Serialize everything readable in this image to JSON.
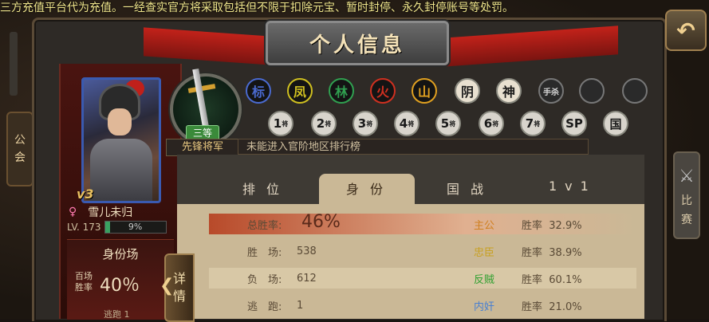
{
  "marquee": "三方充值平台代为充值。一经查实官方将采取包括但不限于扣除元宝、暂时封停、永久封停账号等处罚。",
  "title": "个人信息",
  "back_icon": "↶",
  "side_left": {
    "label1": "公",
    "label2": "会"
  },
  "side_right": {
    "label1": "比",
    "label2": "赛"
  },
  "profile": {
    "vip": "v3",
    "gender": "♀",
    "name": "雪儿未归",
    "level": "LV. 173",
    "exp_percent": "9%",
    "exp_fraction": 0.09,
    "id_title": "身份场",
    "id_sub1": "百场",
    "id_sub2": "胜率",
    "id_percent": "40％",
    "escape": "逃跑 1",
    "detail1": "详",
    "detail2": "情"
  },
  "rank": {
    "tag": "三等",
    "name": "先锋将军",
    "status": "未能进入官阶地区排行榜"
  },
  "badges_row1": [
    {
      "text": "标",
      "color": "#4a6ad0"
    },
    {
      "text": "凤",
      "color": "#d0c020"
    },
    {
      "text": "林",
      "color": "#30a050"
    },
    {
      "text": "火",
      "color": "#d03020"
    },
    {
      "text": "山",
      "color": "#e0a020"
    },
    {
      "text": "阴",
      "color": "grey"
    },
    {
      "text": "神",
      "color": "grey"
    },
    {
      "text": "手杀",
      "color": "dark"
    },
    {
      "text": "",
      "color": "dark"
    },
    {
      "text": "",
      "color": "dark"
    }
  ],
  "badges_row2": [
    {
      "num": "1",
      "sub": "将"
    },
    {
      "num": "2",
      "sub": "将"
    },
    {
      "num": "3",
      "sub": "将"
    },
    {
      "num": "4",
      "sub": "将"
    },
    {
      "num": "5",
      "sub": "将"
    },
    {
      "num": "6",
      "sub": "将"
    },
    {
      "num": "7",
      "sub": "将"
    },
    {
      "num": "SP",
      "sub": ""
    },
    {
      "num": "国",
      "sub": ""
    }
  ],
  "tabs": [
    "排位",
    "身份",
    "国战",
    "1v1"
  ],
  "stats": [
    {
      "label": "总胜率:",
      "value": "46%"
    },
    {
      "label": "胜　场:",
      "value": "538"
    },
    {
      "label": "负　场:",
      "value": "612"
    },
    {
      "label": "逃　跑:",
      "value": "1"
    }
  ],
  "roles": [
    {
      "name": "主公",
      "color": "#d08020",
      "rate_label": "胜率",
      "rate": "32.9%"
    },
    {
      "name": "忠臣",
      "color": "#c8a020",
      "rate_label": "胜率",
      "rate": "38.9%"
    },
    {
      "name": "反贼",
      "color": "#30a030",
      "rate_label": "胜率",
      "rate": "60.1%"
    },
    {
      "name": "内奸",
      "color": "#4a80d0",
      "rate_label": "胜率",
      "rate": "21.0%"
    }
  ]
}
